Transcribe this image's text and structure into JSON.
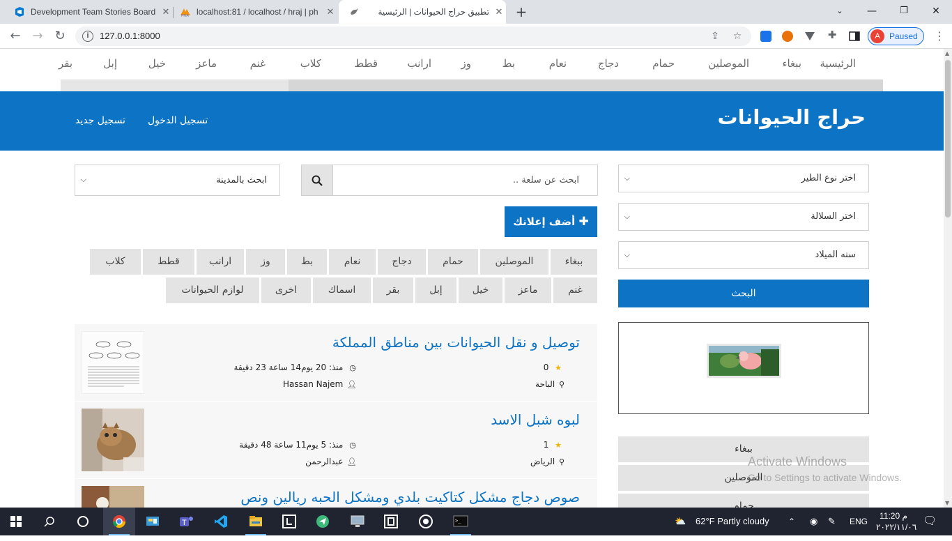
{
  "browser": {
    "tabs": [
      {
        "title": "Development Team Stories Board",
        "close": "✕"
      },
      {
        "title": "localhost:81 / localhost / hraj | ph",
        "close": "✕"
      },
      {
        "title": "تطبيق حراج الحيوانات | الرئيسية",
        "close": "✕"
      }
    ],
    "new_tab": "+",
    "url": "127.0.0.1:8000",
    "profile_initial": "A",
    "profile_status": "Paused"
  },
  "site": {
    "top_nav": [
      "الرئيسية",
      "ببغاء",
      "الموصلين",
      "حمام",
      "دجاج",
      "نعام",
      "بط",
      "وز",
      "ارانب",
      "قطط",
      "كلاب",
      "غنم",
      "ماعز",
      "خيل",
      "إبل",
      "بقر"
    ],
    "brand": "حراج الحيوانات",
    "login": "تسجيل الدخول",
    "register": "تسجيل جديد"
  },
  "filters": {
    "bird_type": "اختر نوع الطير",
    "breed": "اختر السلالة",
    "birth_year": "سنه الميلاد",
    "search_button": "البحث",
    "search_placeholder": "ابحث عن سلعة ..",
    "city": "ابحث بالمدينة",
    "add_ad": "أضف إعلانك"
  },
  "categories_row1": [
    "ببغاء",
    "الموصلين",
    "حمام",
    "دجاج",
    "نعام",
    "بط",
    "وز",
    "ارانب",
    "قطط",
    "كلاب"
  ],
  "categories_row2": [
    "غنم",
    "ماعز",
    "خيل",
    "إبل",
    "بقر",
    "اسماك",
    "اخرى",
    "لوازم الحيوانات"
  ],
  "side_categories": [
    "ببغاء",
    "الموصلين",
    "حمام"
  ],
  "listings": [
    {
      "title": "توصيل و نقل الحيوانات بين مناطق المملكة",
      "rating": "0",
      "city": "الباحة",
      "since": "منذ: 20 يوم14 ساعة 23 دقيقة",
      "user": "Hassan Najem"
    },
    {
      "title": "لبوه شبل الاسد",
      "rating": "1",
      "city": "الرياض",
      "since": "منذ: 5 يوم11 ساعة 48 دقيقة",
      "user": "عبدالرحمن"
    },
    {
      "title": "صوص دجاج مشكل كتاكيت بلدي ومشكل الحبه ريالين ونص",
      "rating": "",
      "city": "",
      "since": "",
      "user": ""
    }
  ],
  "watermark": {
    "line1": "Activate Windows",
    "line2": "Go to Settings to activate Windows."
  },
  "taskbar": {
    "weather": "62°F  Partly cloudy",
    "lang": "ENG",
    "time": "11:20 م",
    "date": "٢٠٢٢/١١/٠٦"
  },
  "colors": {
    "brand_blue": "#0d73c4",
    "star": "#f0b400"
  }
}
